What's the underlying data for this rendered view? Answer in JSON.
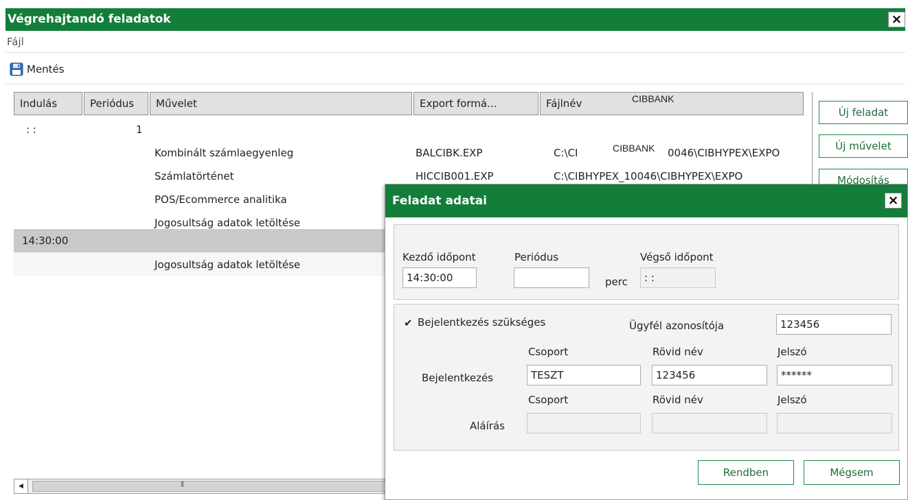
{
  "window": {
    "title": "Végrehajtandó feladatok",
    "close": "×"
  },
  "menu": {
    "file": "Fájl"
  },
  "toolbar": {
    "save": "Mentés"
  },
  "table": {
    "headers": [
      "Indulás",
      "Periódus",
      "Művelet",
      "Export formá...",
      "Fájlnév"
    ],
    "header_overlay": "CIBBANK",
    "task1": {
      "start": ": :",
      "period": "1"
    },
    "rows": [
      {
        "operation": "Kombinált számlaegyenleg",
        "format": "BALCIBK.EXP",
        "file_prefix": "C:\\CI",
        "file_overlay": "CIBBANK",
        "file_suffix": "0046\\CIBHYPEX\\EXPO"
      },
      {
        "operation": "Számlatörténet",
        "format": "HICCIB001.EXP",
        "file": "C:\\CIBHYPEX_10046\\CIBHYPEX\\EXPO"
      },
      {
        "operation": "POS/Ecommerce analitika"
      },
      {
        "operation": "Jogosultság adatok letöltése"
      }
    ],
    "task2": {
      "start": "14:30:00"
    },
    "task2_rows": [
      {
        "operation": "Jogosultság adatok letöltése"
      }
    ]
  },
  "side_buttons": {
    "new_task": "Új feladat",
    "new_operation": "Új művelet",
    "modify": "Módosítás"
  },
  "dialog": {
    "title": "Feladat adatai",
    "close": "×",
    "start_label": "Kezdő időpont",
    "start_value": "14:30:00",
    "period_label": "Periódus",
    "period_value": "",
    "unit": "perc",
    "end_label": "Végső időpont",
    "end_value": ": :",
    "login_required_label": "Bejelentkezés szükséges",
    "login_required_check": "✔",
    "client_id_label": "Ügyfél azonosítója",
    "client_id_value": "123456",
    "col_group": "Csoport",
    "col_short": "Rövid név",
    "col_password": "Jelszó",
    "login_label": "Bejelentkezés",
    "login_group": "TESZT",
    "login_short": "123456",
    "login_password": "******",
    "signature_label": "Aláírás",
    "sig_group": "",
    "sig_short": "",
    "sig_password": "",
    "ok": "Rendben",
    "cancel": "Mégsem"
  },
  "colors": {
    "title_green": "#137d3a",
    "button_border": "#1d8a45",
    "selected_row": "#c9c9c9"
  }
}
